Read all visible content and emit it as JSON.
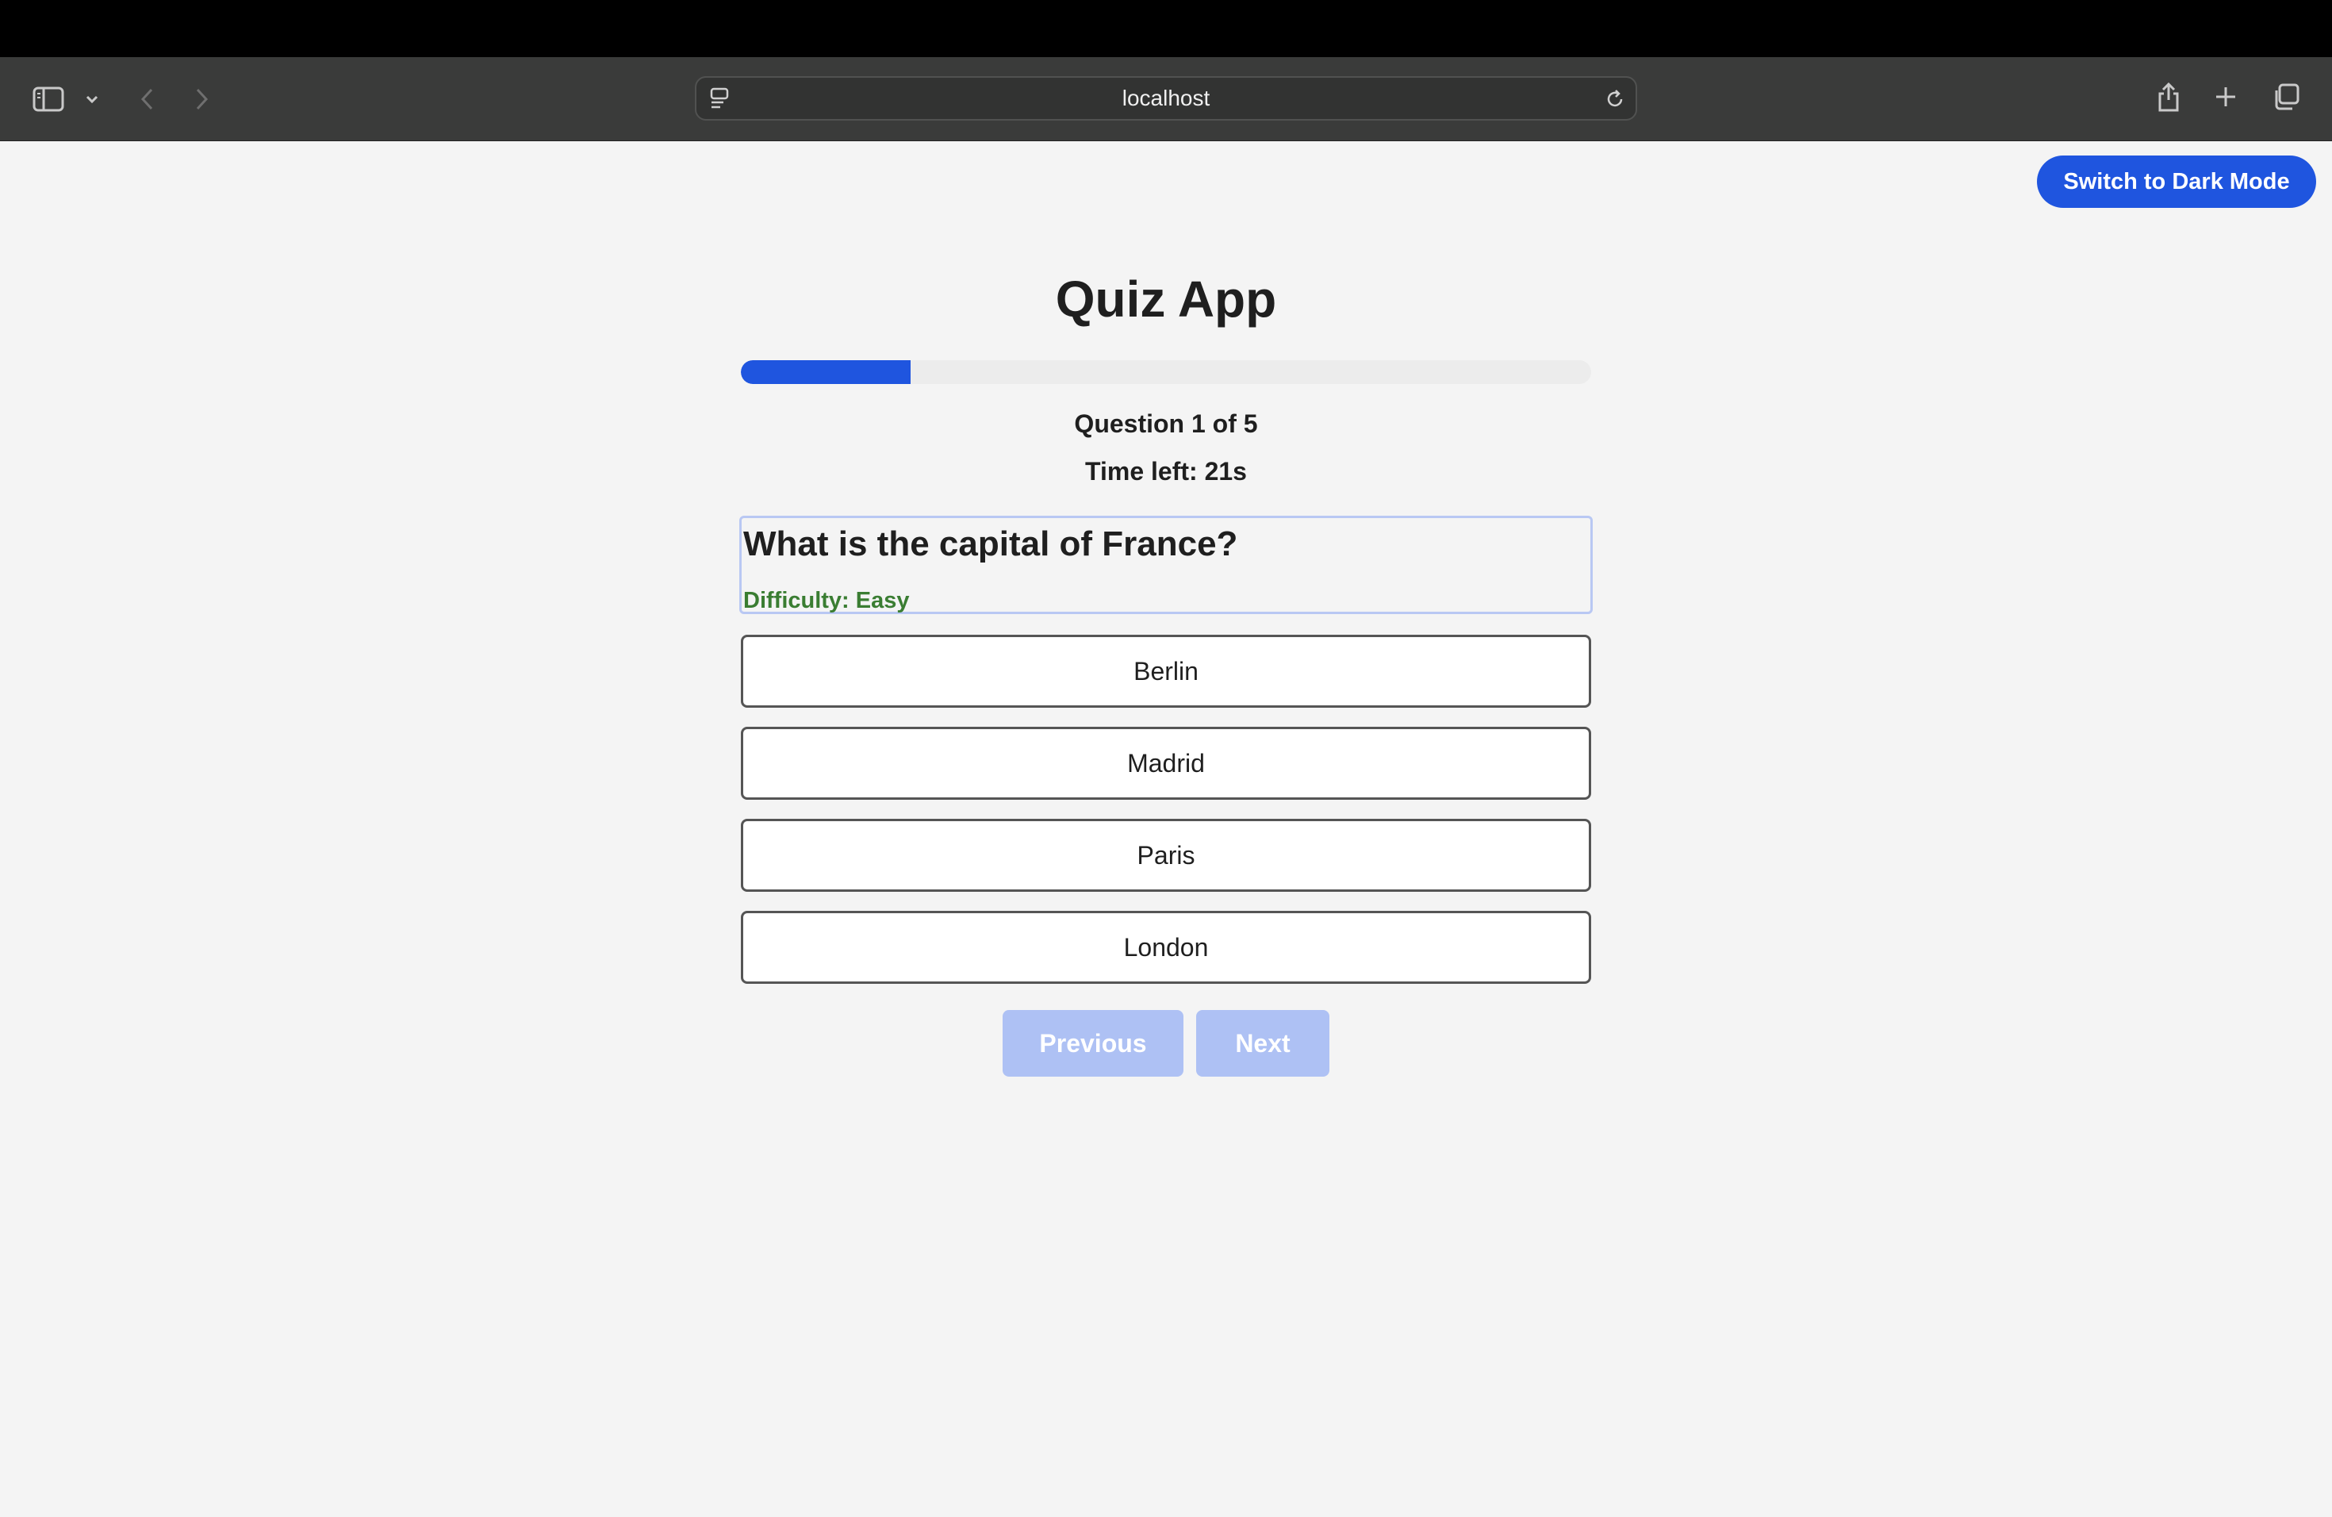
{
  "browser": {
    "url": "localhost"
  },
  "theme_toggle": {
    "label": "Switch to Dark Mode"
  },
  "quiz": {
    "title": "Quiz App",
    "progress_fraction": 0.2,
    "question_counter": "Question 1 of 5",
    "timer": "Time left: 21s",
    "question": "What is the capital of France?",
    "difficulty": "Difficulty: Easy",
    "answers": [
      "Berlin",
      "Madrid",
      "Paris",
      "London"
    ],
    "previous_label": "Previous",
    "next_label": "Next"
  },
  "colors": {
    "accent": "#1f55df",
    "disabled_button": "#aec1f4",
    "difficulty_easy": "#3a7d32"
  }
}
